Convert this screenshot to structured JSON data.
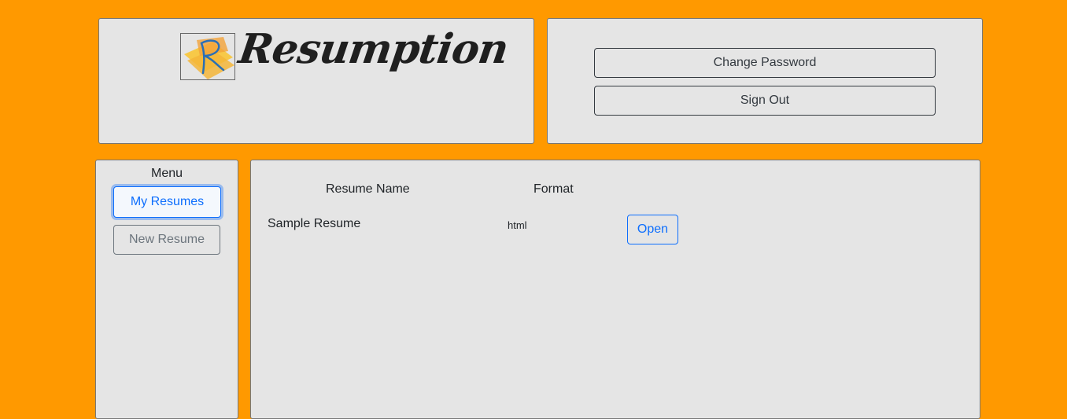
{
  "header": {
    "app_title": "Resumption",
    "logo_icon": "resumption-logo-icon"
  },
  "account": {
    "change_password_label": "Change Password",
    "sign_out_label": "Sign Out"
  },
  "menu": {
    "title": "Menu",
    "items": [
      {
        "label": "My Resumes",
        "active": true
      },
      {
        "label": "New Resume",
        "active": false
      }
    ]
  },
  "resumes": {
    "columns": [
      "Resume Name",
      "Format"
    ],
    "rows": [
      {
        "name": "Sample Resume",
        "format": "html",
        "action_label": "Open"
      }
    ]
  },
  "colors": {
    "background": "#ff9900",
    "panel": "#e5e5e5",
    "primary": "#0d6efd",
    "secondary": "#6c757d",
    "dark": "#343a40"
  }
}
